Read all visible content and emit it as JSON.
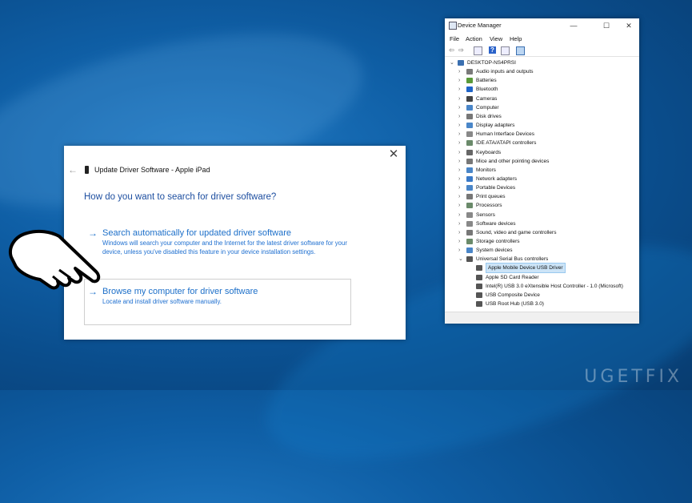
{
  "dialog": {
    "close_glyph": "✕",
    "back_glyph": "←",
    "title": "Update Driver Software - Apple iPad",
    "heading": "How do you want to search for driver software?",
    "options": [
      {
        "arrow": "→",
        "title": "Search automatically for updated driver software",
        "desc": "Windows will search your computer and the Internet for the latest driver software for your device, unless you've disabled this feature in your device installation settings."
      },
      {
        "arrow": "→",
        "title": "Browse my computer for driver software",
        "desc": "Locate and install driver software manually."
      }
    ]
  },
  "device_manager": {
    "title": "Device Manager",
    "window_buttons": [
      "—",
      "☐",
      "✕"
    ],
    "menu": [
      "File",
      "Action",
      "View",
      "Help"
    ],
    "toolbar_icons": [
      "back-arrow-icon",
      "forward-arrow-icon",
      "properties-icon",
      "help-icon",
      "view-icon",
      "monitor-icon"
    ],
    "tree": [
      {
        "label": "DESKTOP-NS4PRSI",
        "level": 0,
        "expander": "⌄",
        "color": "#3a6fb0"
      },
      {
        "label": "Audio inputs and outputs",
        "level": 1,
        "expander": "›",
        "color": "#7a7a7a"
      },
      {
        "label": "Batteries",
        "level": 1,
        "expander": "›",
        "color": "#5a9a3a"
      },
      {
        "label": "Bluetooth",
        "level": 1,
        "expander": "›",
        "color": "#1f64c8"
      },
      {
        "label": "Cameras",
        "level": 1,
        "expander": "›",
        "color": "#444444"
      },
      {
        "label": "Computer",
        "level": 1,
        "expander": "›",
        "color": "#4a86c8"
      },
      {
        "label": "Disk drives",
        "level": 1,
        "expander": "›",
        "color": "#777777"
      },
      {
        "label": "Display adapters",
        "level": 1,
        "expander": "›",
        "color": "#4a86c8"
      },
      {
        "label": "Human Interface Devices",
        "level": 1,
        "expander": "›",
        "color": "#888888"
      },
      {
        "label": "IDE ATA/ATAPI controllers",
        "level": 1,
        "expander": "›",
        "color": "#6a8a6a"
      },
      {
        "label": "Keyboards",
        "level": 1,
        "expander": "›",
        "color": "#666666"
      },
      {
        "label": "Mice and other pointing devices",
        "level": 1,
        "expander": "›",
        "color": "#777777"
      },
      {
        "label": "Monitors",
        "level": 1,
        "expander": "›",
        "color": "#4a86c8"
      },
      {
        "label": "Network adapters",
        "level": 1,
        "expander": "›",
        "color": "#3a7ac8"
      },
      {
        "label": "Portable Devices",
        "level": 1,
        "expander": "›",
        "color": "#4a86c8"
      },
      {
        "label": "Print queues",
        "level": 1,
        "expander": "›",
        "color": "#777777"
      },
      {
        "label": "Processors",
        "level": 1,
        "expander": "›",
        "color": "#6a8a6a"
      },
      {
        "label": "Sensors",
        "level": 1,
        "expander": "›",
        "color": "#888888"
      },
      {
        "label": "Software devices",
        "level": 1,
        "expander": "›",
        "color": "#888888"
      },
      {
        "label": "Sound, video and game controllers",
        "level": 1,
        "expander": "›",
        "color": "#777777"
      },
      {
        "label": "Storage controllers",
        "level": 1,
        "expander": "›",
        "color": "#6a8a6a"
      },
      {
        "label": "System devices",
        "level": 1,
        "expander": "›",
        "color": "#4a86c8"
      },
      {
        "label": "Universal Serial Bus controllers",
        "level": 1,
        "expander": "⌄",
        "color": "#555555"
      },
      {
        "label": "Apple Mobile Device USB Driver",
        "level": 2,
        "expander": "",
        "color": "#555555",
        "selected": true
      },
      {
        "label": "Apple SD Card Reader",
        "level": 2,
        "expander": "",
        "color": "#555555"
      },
      {
        "label": "Intel(R) USB 3.0 eXtensible Host Controller - 1.0 (Microsoft)",
        "level": 2,
        "expander": "",
        "color": "#555555"
      },
      {
        "label": "USB Composite Device",
        "level": 2,
        "expander": "",
        "color": "#555555"
      },
      {
        "label": "USB Root Hub (USB 3.0)",
        "level": 2,
        "expander": "",
        "color": "#555555"
      }
    ]
  },
  "watermark": "UGETFIX"
}
